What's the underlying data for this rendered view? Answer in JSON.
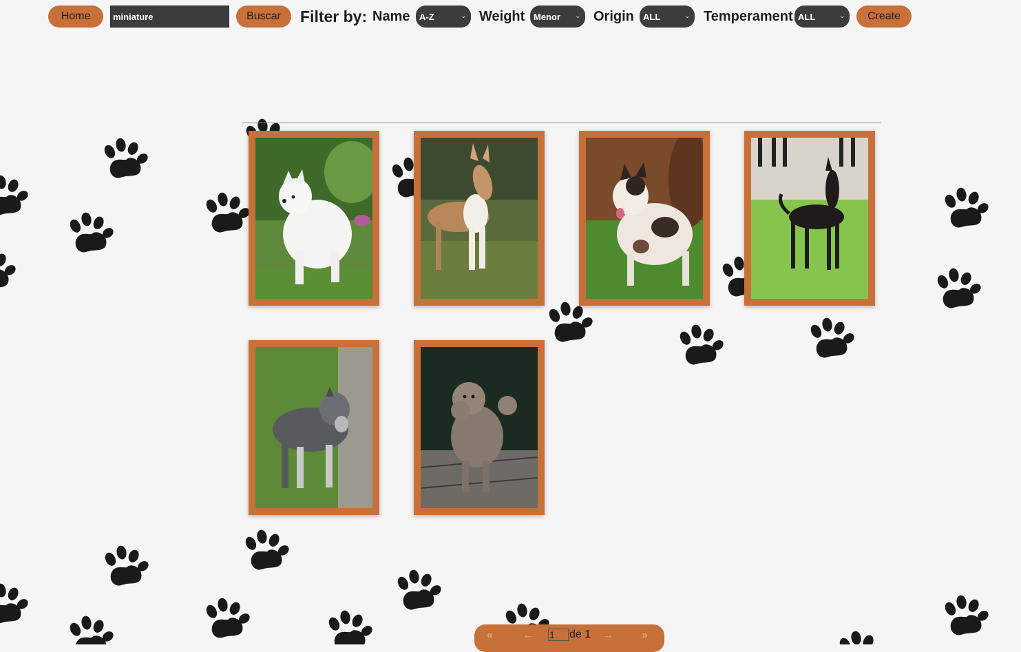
{
  "toolbar": {
    "home_label": "Home",
    "search_value": "miniature",
    "search_label": "Buscar",
    "filter_by_label": "Filter by:",
    "create_label": "Create"
  },
  "filters": {
    "name": {
      "label": "Name",
      "value": "A-Z"
    },
    "weight": {
      "label": "Weight",
      "value": "Menor"
    },
    "origin": {
      "label": "Origin",
      "value": "ALL"
    },
    "temperament": {
      "label": "Temperament",
      "value": "ALL"
    }
  },
  "cards": [
    {
      "image": "white-fluffy-dog-photo"
    },
    {
      "image": "bull-terrier-dog-photo"
    },
    {
      "image": "merle-shepherd-dog-photo"
    },
    {
      "image": "black-pinscher-dog-photo"
    },
    {
      "image": "grey-schnauzer-dog-photo"
    },
    {
      "image": "grey-poodle-dog-photo"
    }
  ],
  "pagination": {
    "current_page": "1",
    "of_label": "de 1",
    "icons": [
      "double-left-arrow-icon",
      "left-arrow-icon",
      "right-arrow-icon",
      "double-right-arrow-icon"
    ]
  },
  "colors": {
    "accent": "#c8703a",
    "select_bg": "#3c3c3c",
    "background": "#f5f5f5",
    "paw": "#1a1a1a"
  }
}
